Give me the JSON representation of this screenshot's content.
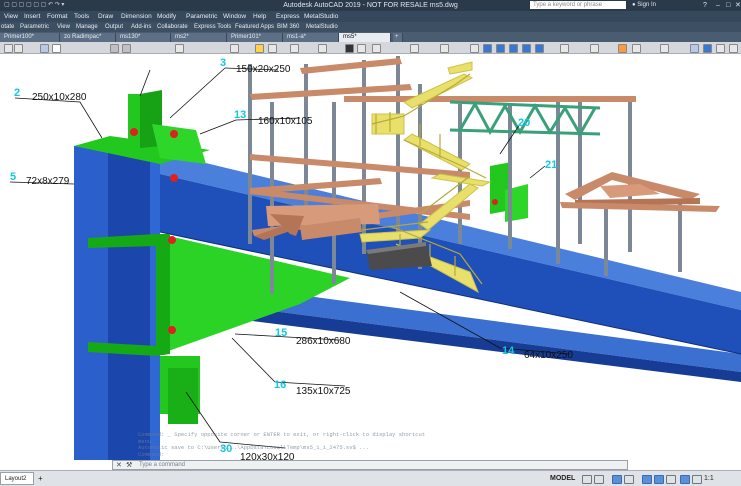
{
  "titlebar": {
    "title": "Autodesk AutoCAD 2019 - NOT FOR RESALE    ms5.dwg",
    "search_placeholder": "Type a keyword or phrase",
    "sign_in": "Sign In",
    "help": "?",
    "minimize": "–",
    "maximize": "□",
    "close": "✕"
  },
  "menu": [
    "View",
    "Insert",
    "Format",
    "Tools",
    "Draw",
    "Dimension",
    "Modify",
    "Parametric",
    "Window",
    "Help",
    "Express",
    "MetalStudio"
  ],
  "ribbon_tabs": [
    "otate",
    "Parametric",
    "View",
    "Manage",
    "Output",
    "Add-ins",
    "Collaborate",
    "Express Tools",
    "Featured Apps",
    "BIM 360",
    "MetalStudio"
  ],
  "doc_tabs": [
    "Primer100*",
    "zo Radimpac*",
    "ms130*",
    "ms2*",
    "Primer101*",
    "ms1-a*",
    "ms5*"
  ],
  "active_doc_tab": "ms5*",
  "plus_tab": "+",
  "labels": [
    {
      "num": "2",
      "dim": "250x10x280"
    },
    {
      "num": "3",
      "dim": "150x20x250"
    },
    {
      "num": "5",
      "dim": "72x8x279"
    },
    {
      "num": "13",
      "dim": "160x10x105"
    },
    {
      "num": "14",
      "dim": "64x10x250"
    },
    {
      "num": "15",
      "dim": "286x10x680"
    },
    {
      "num": "16",
      "dim": "135x10x725"
    },
    {
      "num": "20",
      "dim": ""
    },
    {
      "num": "21",
      "dim": ""
    },
    {
      "num": "30",
      "dim": "120x30x120"
    }
  ],
  "command": {
    "history": [
      "Command: _ Specify opposite corner or ENTER to exit, or right-click to display shortcut menu.",
      "Automatic save to C:\\Users\\...\\AppData\\Local\\Temp\\ms5_1_1_2475.sv$ ...",
      "Command:"
    ],
    "prompt": "Type a command"
  },
  "status": {
    "layout_tab": "Layout2",
    "add_layout": "+",
    "model": "MODEL",
    "scale": "1:1"
  },
  "colors": {
    "beam_blue": "#1f4fb8",
    "plate_green": "#22c81e",
    "bolt_red": "#e02020",
    "steel_grey": "#9aa6b4",
    "timber": "#c98a6a",
    "stair_yellow": "#e8e06a",
    "truss_teal": "#3aa07a",
    "label_cyan": "#14c6e0"
  },
  "icons": [
    "search-icon",
    "user-icon",
    "help-icon",
    "command-close-icon",
    "command-wrench-icon"
  ]
}
